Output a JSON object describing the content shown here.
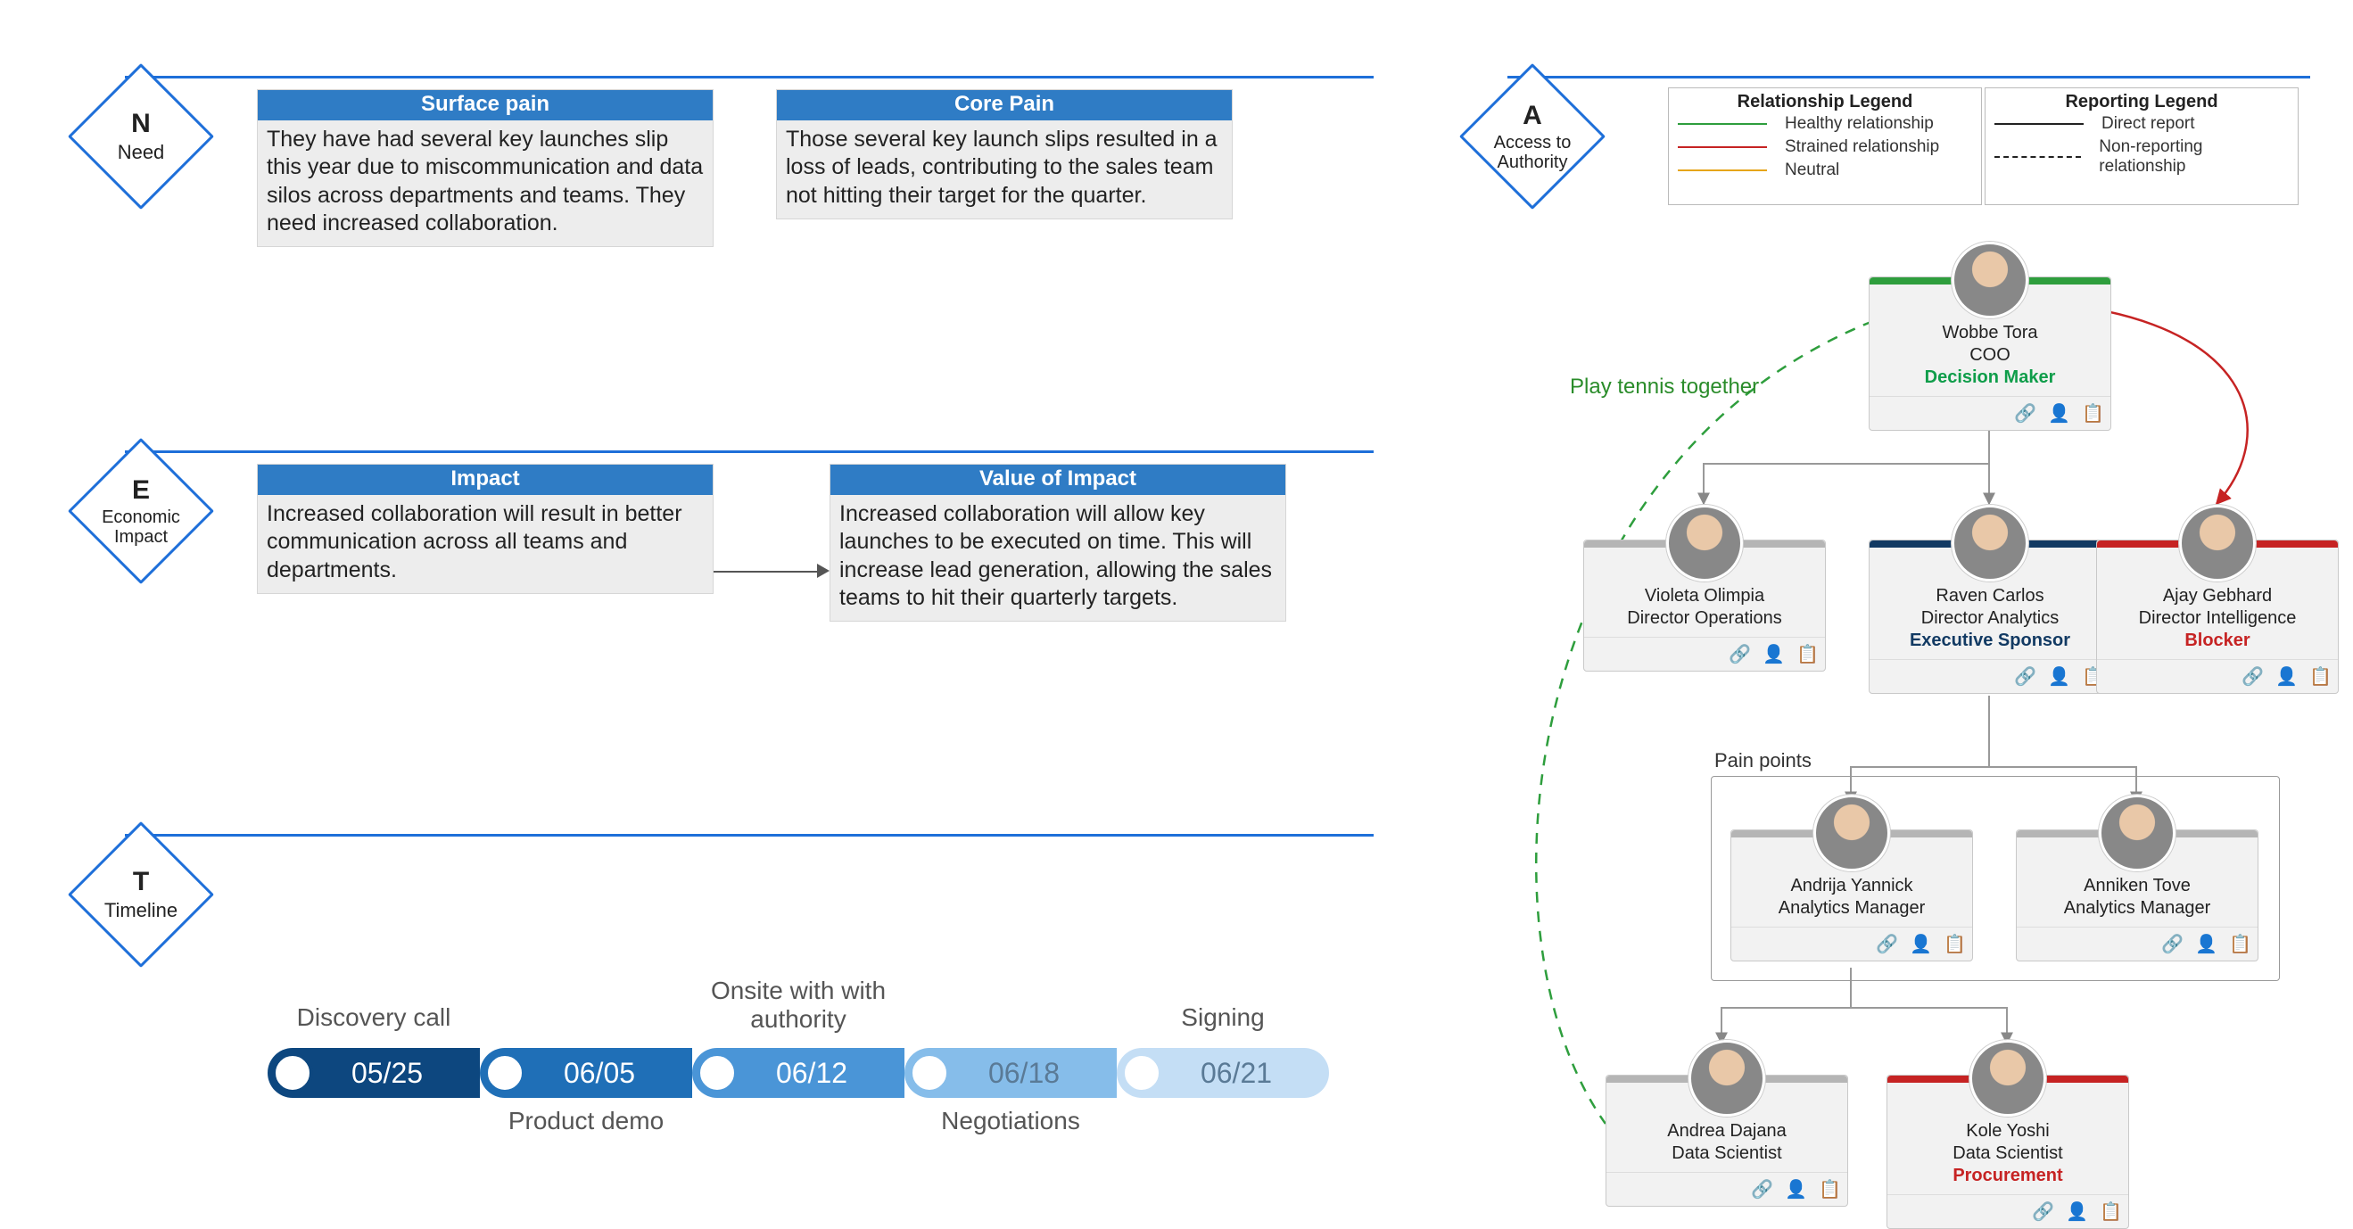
{
  "sections": {
    "need": {
      "letter": "N",
      "label": "Need"
    },
    "econ": {
      "letter": "E",
      "label": "Economic Impact"
    },
    "timeline": {
      "letter": "T",
      "label": "Timeline"
    },
    "access": {
      "letter": "A",
      "label": "Access to Authority"
    }
  },
  "need": {
    "surface": {
      "title": "Surface pain",
      "body": "They have had several key launches slip this year due to miscommunication and data silos across departments and teams. They need increased collaboration."
    },
    "core": {
      "title": "Core Pain",
      "body": "Those several key launch slips resulted in a loss of leads, contributing to the sales team not hitting their target for the quarter."
    }
  },
  "econ": {
    "impact": {
      "title": "Impact",
      "body": "Increased collaboration will result in better communication across all teams and departments."
    },
    "value": {
      "title": "Value of Impact",
      "body": "Increased collaboration will allow key launches to be executed on time. This will increase lead generation, allowing the sales teams to hit their quarterly targets."
    }
  },
  "timeline": {
    "steps": [
      {
        "date": "05/25",
        "label": "Discovery call",
        "color": "#0d477f",
        "label_pos": "top"
      },
      {
        "date": "06/05",
        "label": "Product demo",
        "color": "#1f6fb7",
        "label_pos": "bottom"
      },
      {
        "date": "06/12",
        "label": "Onsite with with authority",
        "color": "#4a95d7",
        "label_pos": "top"
      },
      {
        "date": "06/18",
        "label": "Negotiations",
        "color": "#86bdea",
        "label_pos": "bottom"
      },
      {
        "date": "06/21",
        "label": "Signing",
        "color": "#c4def5",
        "label_pos": "top"
      }
    ]
  },
  "legend": {
    "relationship": {
      "title": "Relationship Legend",
      "items": [
        {
          "label": "Healthy relationship",
          "color": "#2e9e3d"
        },
        {
          "label": "Strained relationship",
          "color": "#c62323"
        },
        {
          "label": "Neutral",
          "color": "#e6a519"
        }
      ]
    },
    "reporting": {
      "title": "Reporting Legend",
      "items": [
        {
          "label": "Direct report",
          "style": "solid"
        },
        {
          "label": "Non-reporting relationship",
          "style": "dashed"
        }
      ]
    }
  },
  "annotations": {
    "tennis": "Play tennis together",
    "pain_group": "Pain points"
  },
  "people": {
    "coo": {
      "name": "Wobbe Tora",
      "title": "COO",
      "tag": "Decision Maker",
      "tag_color": "green",
      "bar": "green"
    },
    "ops": {
      "name": "Violeta Olimpia",
      "title": "Director Operations",
      "tag": "",
      "tag_color": "",
      "bar": "grey"
    },
    "anlx": {
      "name": "Raven Carlos",
      "title": "Director Analytics",
      "tag": "Executive Sponsor",
      "tag_color": "navy",
      "bar": "navy"
    },
    "intel": {
      "name": "Ajay Gebhard",
      "title": "Director Intelligence",
      "tag": "Blocker",
      "tag_color": "red",
      "bar": "red"
    },
    "mgr1": {
      "name": "Andrija Yannick",
      "title": "Analytics Manager",
      "tag": "",
      "tag_color": "",
      "bar": "grey"
    },
    "mgr2": {
      "name": "Anniken Tove",
      "title": "Analytics Manager",
      "tag": "",
      "tag_color": "",
      "bar": "grey"
    },
    "ds1": {
      "name": "Andrea Dajana",
      "title": "Data Scientist",
      "tag": "",
      "tag_color": "",
      "bar": "grey"
    },
    "ds2": {
      "name": "Kole Yoshi",
      "title": "Data Scientist",
      "tag": "Procurement",
      "tag_color": "red",
      "bar": "red"
    }
  },
  "card_icons": {
    "link": "link-icon",
    "person": "person-icon",
    "notes": "notes-icon"
  }
}
